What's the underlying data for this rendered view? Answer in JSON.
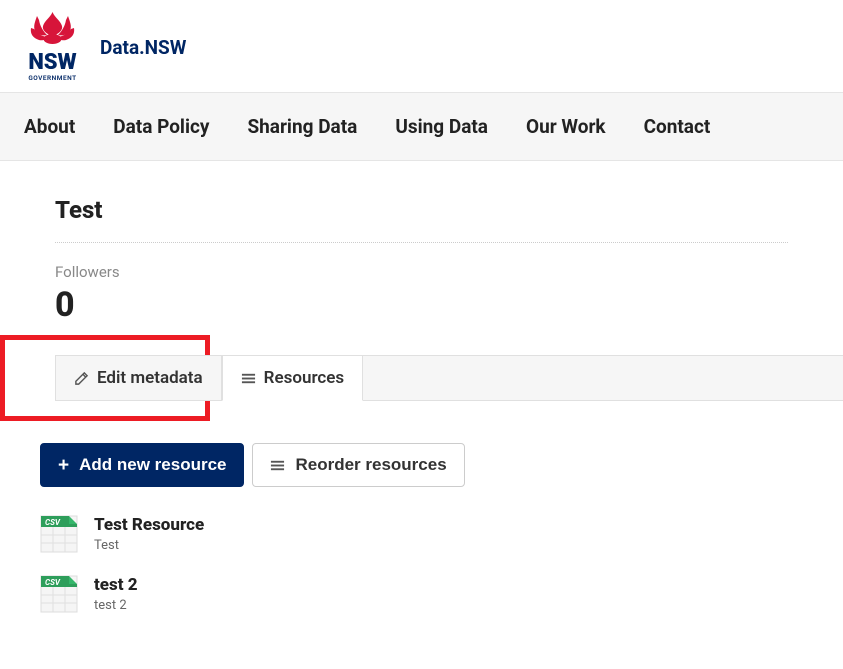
{
  "header": {
    "logo_top": "NSW",
    "logo_bottom": "GOVERNMENT",
    "site_title": "Data.NSW"
  },
  "nav": {
    "items": [
      {
        "label": "About"
      },
      {
        "label": "Data Policy"
      },
      {
        "label": "Sharing Data"
      },
      {
        "label": "Using Data"
      },
      {
        "label": "Our Work"
      },
      {
        "label": "Contact"
      }
    ]
  },
  "dataset": {
    "title": "Test",
    "followers_label": "Followers",
    "followers_count": "0"
  },
  "tabs": {
    "edit_metadata": "Edit metadata",
    "resources": "Resources"
  },
  "actions": {
    "add_new_resource": "Add new resource",
    "reorder_resources": "Reorder resources"
  },
  "resources": [
    {
      "name": "Test Resource",
      "description": "Test",
      "format": "CSV"
    },
    {
      "name": "test 2",
      "description": "test 2",
      "format": "CSV"
    }
  ]
}
